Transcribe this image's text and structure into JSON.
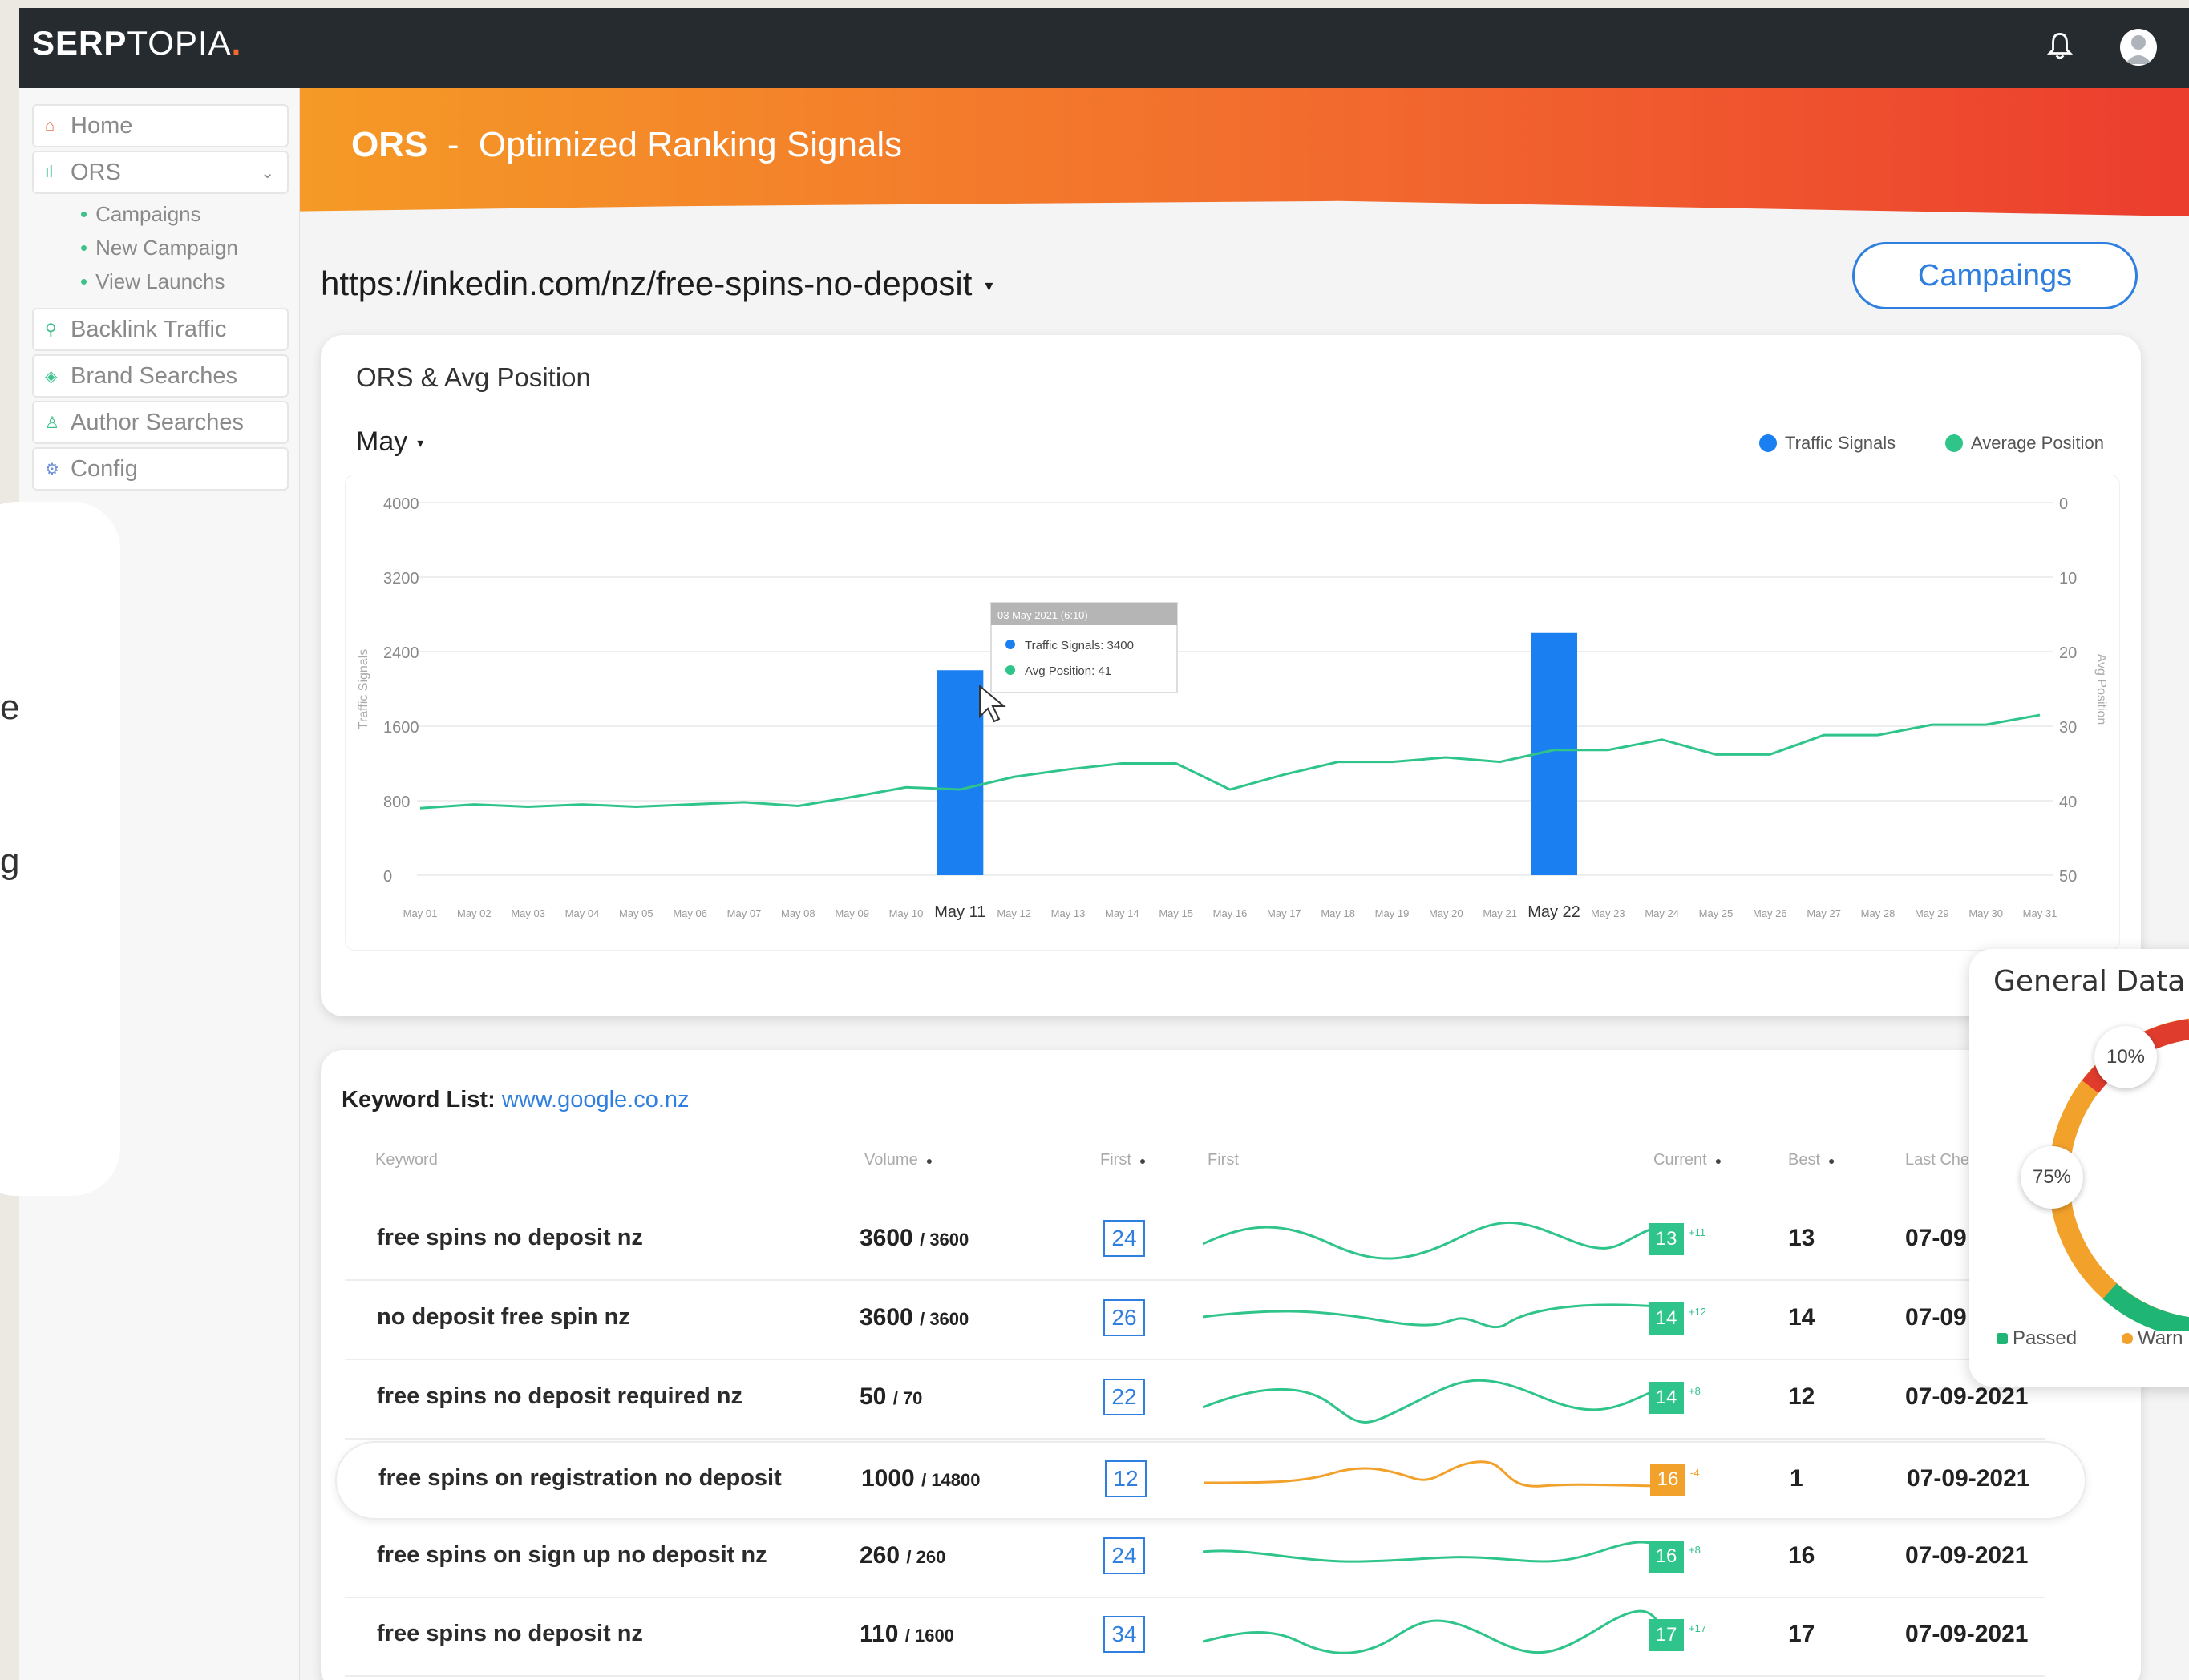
{
  "brand": {
    "bold": "SERP",
    "rest": "TOPIA",
    "dot": "."
  },
  "header": {
    "bell_icon": "bell-icon",
    "user_icon": "user-avatar-icon"
  },
  "sidebar": {
    "home": "Home",
    "ors": "ORS",
    "sub_items": [
      "Campaigns",
      "New Campaign",
      "View Launchs"
    ],
    "backlink": "Backlink Traffic",
    "brand": "Brand Searches",
    "author": "Author Searches",
    "config": "Config"
  },
  "left_card": {
    "text_a": "e",
    "text_b": "g"
  },
  "banner": {
    "abbr": "ORS",
    "sep": "-",
    "name": "Optimized Ranking Signals"
  },
  "page": {
    "url": "https://inkedin.com/nz/free-spins-no-deposit",
    "caret": "▾",
    "campaigns_button": "Campaings"
  },
  "chart_card": {
    "title": "ORS & Avg Position",
    "month": "May",
    "legend": [
      {
        "label": "Traffic Signals",
        "color": "#1a7ff0"
      },
      {
        "label": "Average Position",
        "color": "#2fc48a"
      }
    ],
    "tooltip": {
      "header": "03 May 2021 (6:10)",
      "line1": "Traffic Signals: 3400",
      "line2": "Avg Position: 41"
    },
    "y_left_label": "Traffic Signals",
    "y_right_label": "Avg Position"
  },
  "chart_data": {
    "type": "bar",
    "categories": [
      "May 01",
      "May 02",
      "May 03",
      "May 04",
      "May 05",
      "May 06",
      "May 07",
      "May 08",
      "May 09",
      "May 10",
      "May 11",
      "May 12",
      "May 13",
      "May 14",
      "May 15",
      "May 16",
      "May 17",
      "May 18",
      "May 19",
      "May 20",
      "May 21",
      "May 22",
      "May 23",
      "May 24",
      "May 25",
      "May 26",
      "May 27",
      "May 28",
      "May 29",
      "May 30",
      "May 31"
    ],
    "y_left_ticks": [
      4000,
      3200,
      2400,
      1600,
      800,
      0
    ],
    "y_right_ticks": [
      0,
      10,
      20,
      30,
      40,
      50
    ],
    "ylim_left": [
      0,
      4000
    ],
    "ylim_right": [
      50,
      0
    ],
    "series": [
      {
        "name": "Traffic Signals",
        "type": "bar",
        "color": "#1a7ff0",
        "points": [
          {
            "x": "May 11",
            "y": 2200
          },
          {
            "x": "May 22",
            "y": 2600
          }
        ]
      },
      {
        "name": "Average Position",
        "type": "line",
        "color": "#2fc48a",
        "values": [
          41,
          40.5,
          40.8,
          40.5,
          40.8,
          40.5,
          40.2,
          40.7,
          39.5,
          38.2,
          38.5,
          36.8,
          35.8,
          35,
          35,
          38.5,
          36.5,
          34.8,
          34.8,
          34.2,
          34.8,
          33.2,
          33.2,
          31.8,
          33.8,
          33.8,
          31.2,
          31.2,
          29.8,
          29.8,
          28.5
        ]
      }
    ],
    "grid": true
  },
  "keywords": {
    "title": "Keyword List:",
    "domain": "www.google.co.nz",
    "headers": {
      "keyword": "Keyword",
      "volume": "Volume",
      "first": "First",
      "first_graph": "First",
      "current": "Current",
      "best": "Best",
      "last": "Last Che"
    },
    "rows": [
      {
        "kw": "free spins no deposit nz",
        "vol": "3600",
        "vol2": "/ 3600",
        "first": "24",
        "cur": "13",
        "delta": "+11",
        "best": "13",
        "last": "07-09",
        "color": "#2fc48a"
      },
      {
        "kw": "no deposit free spin nz",
        "vol": "3600",
        "vol2": "/ 3600",
        "first": "26",
        "cur": "14",
        "delta": "+12",
        "best": "14",
        "last": "07-09",
        "color": "#2fc48a"
      },
      {
        "kw": "free spins no deposit required nz",
        "vol": "50",
        "vol2": "/ 70",
        "first": "22",
        "cur": "14",
        "delta": "+8",
        "best": "12",
        "last": "07-09-2021",
        "color": "#2fc48a"
      },
      {
        "kw": "free spins on registration no deposit",
        "vol": "1000",
        "vol2": "/ 14800",
        "first": "12",
        "cur": "16",
        "delta": "-4",
        "best": "1",
        "last": "07-09-2021",
        "color": "#f2a12b"
      },
      {
        "kw": "free spins on sign up no deposit nz",
        "vol": "260",
        "vol2": "/ 260",
        "first": "24",
        "cur": "16",
        "delta": "+8",
        "best": "16",
        "last": "07-09-2021",
        "color": "#2fc48a"
      },
      {
        "kw": "free spins no deposit nz",
        "vol": "110",
        "vol2": "/ 1600",
        "first": "34",
        "cur": "17",
        "delta": "+17",
        "best": "17",
        "last": "07-09-2021",
        "color": "#2fc48a"
      }
    ]
  },
  "general_data": {
    "title": "General Data",
    "pct_a": "10%",
    "pct_b": "75%",
    "legend": [
      {
        "label": "Passed",
        "color": "#1fb574"
      },
      {
        "label": "Warn",
        "color": "#f2a12b"
      }
    ]
  }
}
